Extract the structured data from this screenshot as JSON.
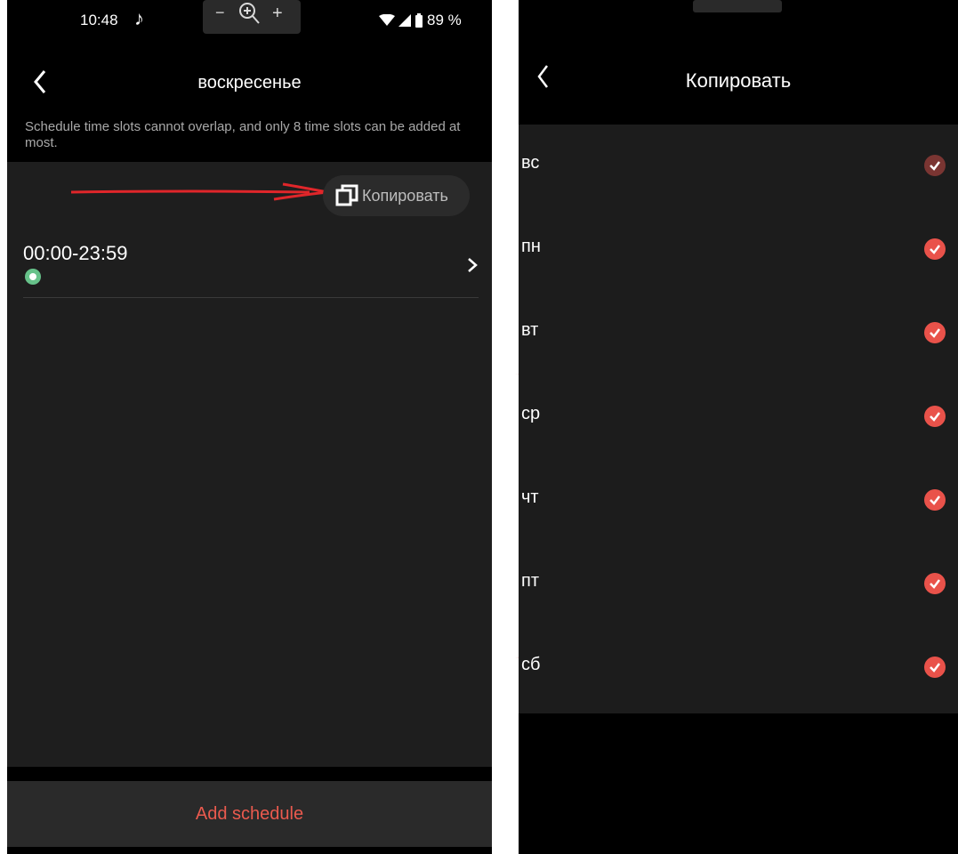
{
  "left": {
    "status": {
      "time": "10:48",
      "zoom_minus": "−",
      "zoom_plus": "+",
      "battery": "89 %"
    },
    "header": {
      "title": "воскресенье"
    },
    "note": "Schedule time slots cannot overlap, and only 8 time slots can be added at most.",
    "copy_button": {
      "label": "Копировать"
    },
    "slot": {
      "time": "00:00-23:59"
    },
    "add_button": {
      "label": "Add schedule"
    }
  },
  "right": {
    "header": {
      "title": "Копировать"
    },
    "days": [
      {
        "label": "вс",
        "checked": true,
        "disabled": true
      },
      {
        "label": "пн",
        "checked": true
      },
      {
        "label": "вт",
        "checked": true
      },
      {
        "label": "ср",
        "checked": true
      },
      {
        "label": "чт",
        "checked": true
      },
      {
        "label": "пт",
        "checked": true
      },
      {
        "label": "сб",
        "checked": true
      }
    ]
  },
  "colors": {
    "accent": "#e9524a",
    "panel": "#1e1e1e",
    "clock_badge": "#67c28a"
  }
}
